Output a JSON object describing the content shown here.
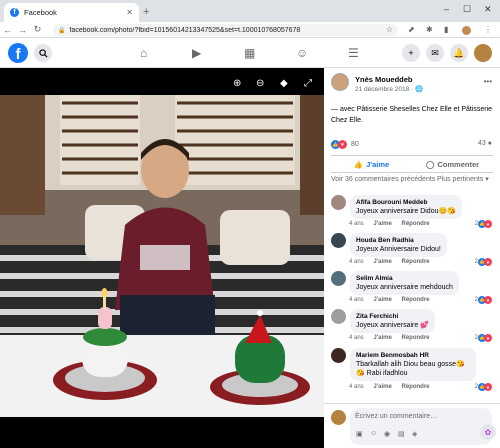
{
  "browser": {
    "tab_title": "Facebook",
    "url": "facebook.com/photo/?fbid=10156014213347525&set=t.100010768057678",
    "new_tab_symbol": "+",
    "window_controls": [
      "‒",
      "☐",
      "✕"
    ]
  },
  "nav": {
    "logo_letter": "f"
  },
  "post": {
    "author": "Ynès Moueddeb",
    "date": "21 décembre 2018 · 🌐",
    "text": "— avec Pâtisserie Sheselles Chez Elle et Pâtisserie Chez Elle.",
    "reaction_count": "80",
    "comment_count": "43",
    "like_label": "J'aime",
    "comment_label": "Commenter",
    "view_more": "Voir 36 commentaires précédents",
    "sort_label": "Plus pertinents ▾"
  },
  "comments": [
    {
      "name": "Afifa Bourouni Meddeb",
      "text": "Joyeux anniversaire Didou😊😘",
      "age": "4 ans",
      "like": "J'aime",
      "reply": "Répondre",
      "reactions": "2"
    },
    {
      "name": "Houda Ben Radhia",
      "text": "Joyeux Anniversaire Didou!",
      "age": "4 ans",
      "like": "J'aime",
      "reply": "Répondre",
      "reactions": "2"
    },
    {
      "name": "Selim Almia",
      "text": "Joyeux anniversaire mehdouch",
      "age": "4 ans",
      "like": "J'aime",
      "reply": "Répondre",
      "reactions": "2"
    },
    {
      "name": "Zita Ferchichi",
      "text": "Joyeux anniversaire 💕",
      "age": "4 ans",
      "like": "J'aime",
      "reply": "Répondre",
      "reactions": "2"
    },
    {
      "name": "Mariem Benmosbah HR",
      "text": "Tbarkallah alih Diou beau gosse😘😘 Rabi ifadhlou",
      "age": "4 ans",
      "like": "J'aime",
      "reply": "Répondre",
      "reactions": "2"
    }
  ],
  "composer": {
    "placeholder": "Écrivez un commentaire…"
  },
  "colors": {
    "brand": "#1877f2",
    "love": "#f33e58"
  }
}
